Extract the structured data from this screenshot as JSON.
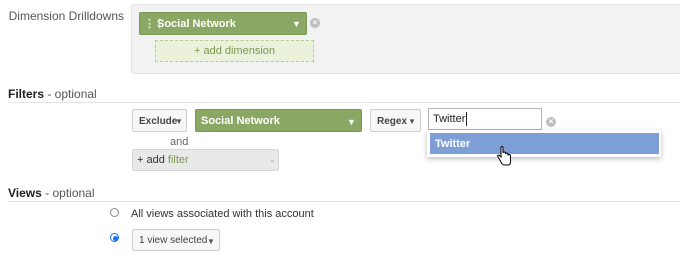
{
  "drilldowns": {
    "label": "Dimension Drilldowns",
    "dimension_value": "Social Network",
    "add_dimension_label": "+ add dimension"
  },
  "filters": {
    "title": "Filters",
    "optional": " - optional",
    "mode_value": "Exclude",
    "dimension_value": "Social Network",
    "match_type_value": "Regex",
    "expression_value": "Twitter",
    "suggestion": "Twitter",
    "and_label": "and",
    "add_filter_prefix": "+ add",
    "add_filter_word": "filter"
  },
  "views": {
    "title": "Views",
    "optional": " - optional",
    "all_views_label": "All views associated with this account",
    "selected_views_value": "1 view selected",
    "selected_option": "selected_views"
  },
  "colors": {
    "accent_green": "#8aa864",
    "suggestion_blue": "#7e9fd6",
    "radio_blue": "#1a73e8"
  },
  "icons": {
    "grip": "drag-handle-icon",
    "dropdown": "caret-down-icon",
    "remove": "remove-circle-icon",
    "cursor": "hand-pointer-icon"
  }
}
